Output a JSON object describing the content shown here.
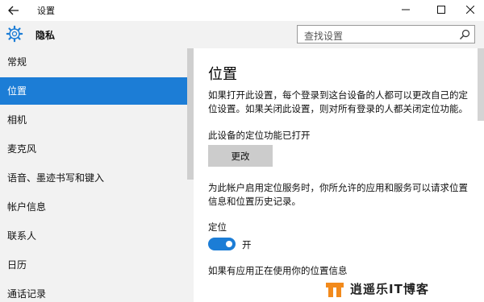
{
  "window": {
    "title": "设置",
    "controls": [
      "minimize",
      "maximize",
      "close"
    ]
  },
  "header": {
    "section_title": "隐私",
    "search": {
      "placeholder": "查找设置",
      "value": ""
    }
  },
  "sidebar": {
    "items": [
      {
        "label": "常规",
        "active": false
      },
      {
        "label": "位置",
        "active": true
      },
      {
        "label": "相机",
        "active": false
      },
      {
        "label": "麦克风",
        "active": false
      },
      {
        "label": "语音、墨迹书写和键入",
        "active": false
      },
      {
        "label": "帐户信息",
        "active": false
      },
      {
        "label": "联系人",
        "active": false
      },
      {
        "label": "日历",
        "active": false
      },
      {
        "label": "通话记录",
        "active": false
      }
    ]
  },
  "main": {
    "title": "位置",
    "description": "如果打开此设置，每个登录到这台设备的人都可以更改自己的定位设置。如果关闭此设置，则对所有登录的人都关闭定位功能。",
    "device_status": "此设备的定位功能已打开",
    "change_button": "更改",
    "account_desc": "为此帐户启用定位服务时，你所允许的应用和服务可以请求位置信息和位置历史记录。",
    "location_label": "定位",
    "toggle": {
      "state": "on",
      "label": "开"
    },
    "footer_text": "如果有应用正在使用你的位置信息"
  },
  "watermark": {
    "text": "逍遥乐IT博客",
    "logo_accent": "#f28a1c"
  },
  "colors": {
    "accent": "#1c7dd6",
    "sidebar_bg": "#f2f2f2"
  }
}
